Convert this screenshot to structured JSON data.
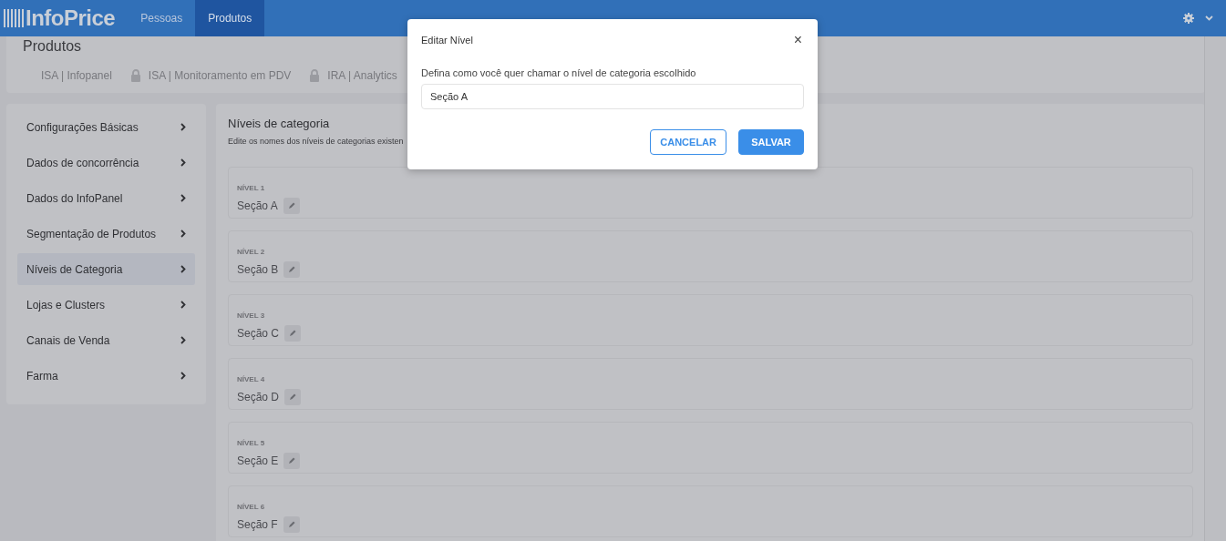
{
  "header": {
    "logo": "InfoPrice",
    "nav": [
      {
        "label": "Pessoas",
        "selected": false
      },
      {
        "label": "Produtos",
        "selected": true
      }
    ]
  },
  "page_title": "Produtos",
  "tabs": [
    {
      "label": "ISA | Infopanel",
      "locked": false
    },
    {
      "label": "ISA | Monitoramento em PDV",
      "locked": true
    },
    {
      "label": "IRA | Analytics",
      "locked": true
    }
  ],
  "sidebar": {
    "items": [
      {
        "label": "Configurações Básicas",
        "selected": false
      },
      {
        "label": "Dados de concorrência",
        "selected": false
      },
      {
        "label": "Dados do InfoPanel",
        "selected": false
      },
      {
        "label": "Segmentação de Produtos",
        "selected": false
      },
      {
        "label": "Níveis de Categoria",
        "selected": true
      },
      {
        "label": "Lojas e Clusters",
        "selected": false
      },
      {
        "label": "Canais de Venda",
        "selected": false
      },
      {
        "label": "Farma",
        "selected": false
      }
    ]
  },
  "section": {
    "title": "Níveis de categoria",
    "subtitle": "Edite os nomes dos níveis de categorias existen",
    "levels": [
      {
        "label": "NÍVEL 1",
        "name": "Seção A"
      },
      {
        "label": "NÍVEL 2",
        "name": "Seção B"
      },
      {
        "label": "NÍVEL 3",
        "name": "Seção C"
      },
      {
        "label": "NÍVEL 4",
        "name": "Seção D"
      },
      {
        "label": "NÍVEL 5",
        "name": "Seção E"
      },
      {
        "label": "NÍVEL 6",
        "name": "Seção F"
      }
    ]
  },
  "dialog": {
    "title": "Editar Nível",
    "close": "×",
    "prompt": "Defina como você quer chamar o nível de categoria escolhido",
    "value": "Seção A",
    "buttons": [
      {
        "label": "CANCELAR",
        "kind": "secondary"
      },
      {
        "label": "SALVAR",
        "kind": "primary"
      }
    ]
  }
}
